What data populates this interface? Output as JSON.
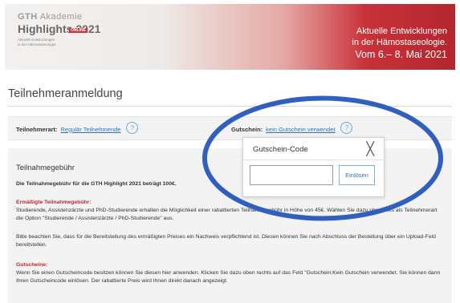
{
  "banner": {
    "logo_gth": "GTH",
    "logo_akademie": "Akademie",
    "logo_highlights": "Highlights 2021",
    "logo_badge": "ONLINE",
    "logo_sub_1": "Aktuelle Entwicklungen",
    "logo_sub_2": "in der Hämostaseologie",
    "title_line_1": "Aktuelle Entwicklungen",
    "title_line_2": "in der Hämostaseologie.",
    "date": "Vom 6.– 8. Mai 2021"
  },
  "page": {
    "title": "Teilnehmeranmeldung"
  },
  "options_bar": {
    "participant_label": "Teilnehmerart:",
    "participant_value": "Regulär Teilnehmende",
    "voucher_label": "Gutschein:",
    "voucher_value": "kein Gutschein verwendet",
    "help_glyph": "?"
  },
  "fee_section": {
    "heading": "Teilnahmegebühr",
    "fee_text": "Die Teilnahmegebühr für die GTH Highlight 2021 beträgt 100€.",
    "reduced_heading": "Ermäßigte Teilnahmegebühr:",
    "reduced_text": "Studierende, Assistenzärzte und PhD-Studierende erhalten die Möglichkeit einer rabattierten Teilnahmegebühr in Höhe von 45€. Wählen Sie dazu oben links als Teilnehmerart die Option \"Studierende / Assistenzärzte / PhD-Studierende\" aus.",
    "proof_text": "Bitte beachten Sie, dass für die Bereitstellung des ermäßigten Preises ein Nachweis verpflichtend ist. Diesen können Sie nach Abschluss der Bestellung über ein Upload-Feld bereitstellen.",
    "voucher_heading": "Gutscheine:",
    "voucher_text": "Wenn Sie einen Gutscheincode besitzen können Sie diesen hier anwenden. Klicken Sie dazu oben rechts auf das Feld \"Gutschein:Kein Gutschein verwendet. Sie können dann Ihren Gutscheincode einlösen. Der rabattierte Preis wird Ihnen direkt danach angezeigt."
  },
  "voucher_modal": {
    "title": "Gutschein-Code",
    "close_glyph": "╳",
    "input_value": "",
    "button_label": "Einlösen"
  },
  "colors": {
    "accent_red": "#c0282e",
    "link_blue": "#2e74b5",
    "annotation_blue": "#2f5fbf"
  }
}
